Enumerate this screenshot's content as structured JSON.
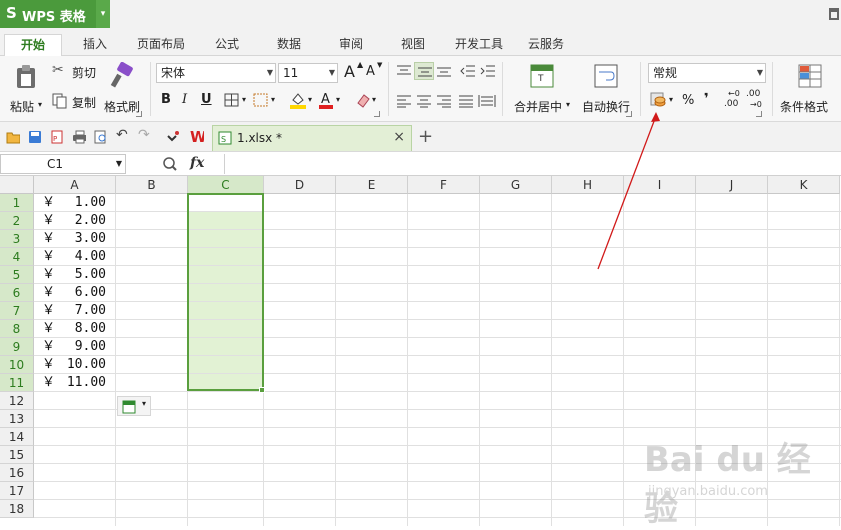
{
  "app": {
    "logo_glyph": "S",
    "title": "WPS 表格",
    "menu_arrow": "▾"
  },
  "ribbon_tabs": [
    "开始",
    "插入",
    "页面布局",
    "公式",
    "数据",
    "审阅",
    "视图",
    "开发工具",
    "云服务"
  ],
  "active_tab": "开始",
  "clipboard": {
    "paste": "粘贴",
    "cut": "剪切",
    "copy": "复制",
    "format_painter": "格式刷"
  },
  "font": {
    "name": "宋体",
    "size": "11",
    "bold": "B",
    "italic": "I",
    "underline": "U",
    "grow": "A",
    "shrink": "A"
  },
  "alignment": {
    "merge_center": "合并居中",
    "wrap_text": "自动换行"
  },
  "number": {
    "format": "常规",
    "percent": "%",
    "comma": "❜",
    "increase_decimal": ".00",
    "decrease_decimal": ".00"
  },
  "styles": {
    "conditional_format": "条件格式"
  },
  "document_tab": {
    "name": "1.xlsx *",
    "close": "×",
    "new_tab": "+"
  },
  "formula_bar": {
    "name_box": "C1",
    "fx": "fx",
    "formula": ""
  },
  "columns": [
    "A",
    "B",
    "C",
    "D",
    "E",
    "F",
    "G",
    "H",
    "I",
    "J",
    "K"
  ],
  "selected_column": "C",
  "rows": [
    "1",
    "2",
    "3",
    "4",
    "5",
    "6",
    "7",
    "8",
    "9",
    "10",
    "11",
    "12",
    "13",
    "14",
    "15",
    "16",
    "17",
    "18"
  ],
  "column_a_values": [
    {
      "symbol": "￥",
      "value": "1.00"
    },
    {
      "symbol": "￥",
      "value": "2.00"
    },
    {
      "symbol": "￥",
      "value": "3.00"
    },
    {
      "symbol": "￥",
      "value": "4.00"
    },
    {
      "symbol": "￥",
      "value": "5.00"
    },
    {
      "symbol": "￥",
      "value": "6.00"
    },
    {
      "symbol": "￥",
      "value": "7.00"
    },
    {
      "symbol": "￥",
      "value": "8.00"
    },
    {
      "symbol": "￥",
      "value": "9.00"
    },
    {
      "symbol": "￥",
      "value": "10.00"
    },
    {
      "symbol": "￥",
      "value": "11.00"
    }
  ],
  "selection_range": "C1:C11",
  "annotation_color": "#d11a1a",
  "accent_color": "#4b9a3c",
  "watermark": {
    "logo": "Bai du 经验",
    "url": "jingyan.baidu.com"
  }
}
